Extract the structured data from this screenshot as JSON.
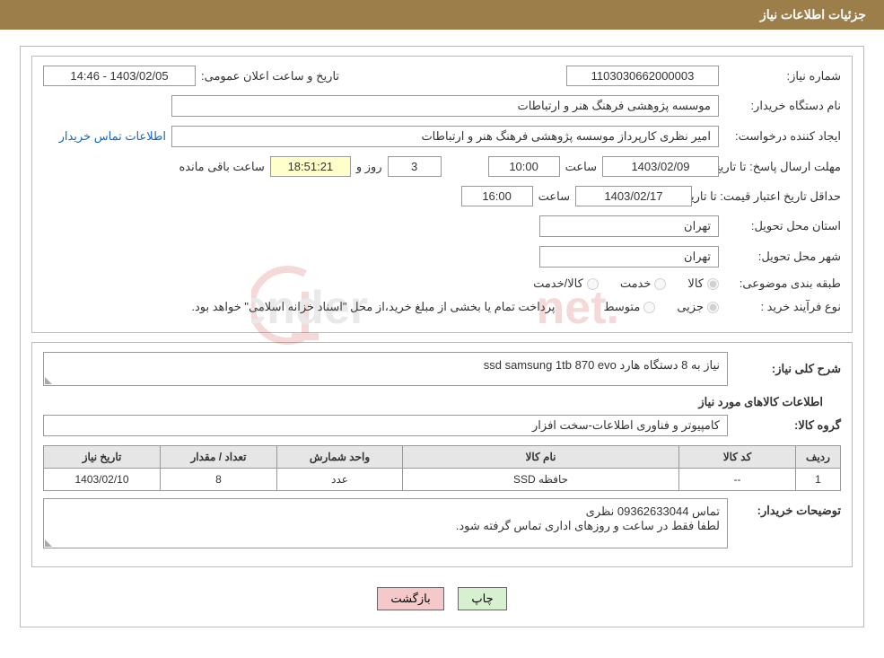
{
  "header": {
    "title": "جزئیات اطلاعات نیاز"
  },
  "info": {
    "need_no_label": "شماره نیاز:",
    "need_no": "1103030662000003",
    "announce_label": "تاریخ و ساعت اعلان عمومی:",
    "announce_value": "1403/02/05 - 14:46",
    "buyer_org_label": "نام دستگاه خریدار:",
    "buyer_org": "موسسه پژوهشی فرهنگ  هنر و ارتباطات",
    "requester_label": "ایجاد کننده درخواست:",
    "requester": "امیر نظری کارپرداز موسسه پژوهشی فرهنگ  هنر و ارتباطات",
    "contact_link": "اطلاعات تماس خریدار",
    "deadline_label": "مهلت ارسال پاسخ: تا تاریخ:",
    "deadline_date": "1403/02/09",
    "time_label": "ساعت",
    "deadline_time": "10:00",
    "days_remain": "3",
    "days_and_label": "روز و",
    "hms_remain": "18:51:21",
    "remain_label": "ساعت باقی مانده",
    "min_validity_label": "حداقل تاریخ اعتبار قیمت: تا تاریخ:",
    "min_validity_date": "1403/02/17",
    "min_validity_time": "16:00",
    "province_label": "استان محل تحویل:",
    "province": "تهران",
    "city_label": "شهر محل تحویل:",
    "city": "تهران",
    "category_label": "طبقه بندی موضوعی:",
    "cat_goods": "کالا",
    "cat_service": "خدمت",
    "cat_goods_service": "کالا/خدمت",
    "purchase_type_label": "نوع فرآیند خرید :",
    "pt_partial": "جزیی",
    "pt_medium": "متوسط",
    "purchase_desc": "پرداخت تمام یا بخشی از مبلغ خرید،از محل \"اسناد خزانه اسلامی\" خواهد بود."
  },
  "need": {
    "summary_label": "شرح کلی نیاز:",
    "summary": "نیاز به 8 دستگاه هارد ssd samsung 1tb 870 evo",
    "items_title": "اطلاعات کالاهای مورد نیاز",
    "group_label": "گروه کالا:",
    "group": "کامپیوتر و فناوری اطلاعات-سخت افزار",
    "table": {
      "headers": [
        "ردیف",
        "کد کالا",
        "نام کالا",
        "واحد شمارش",
        "تعداد / مقدار",
        "تاریخ نیاز"
      ],
      "rows": [
        {
          "idx": "1",
          "code": "--",
          "name": "حافظه SSD",
          "unit": "عدد",
          "qty": "8",
          "date": "1403/02/10"
        }
      ]
    },
    "buyer_notes_label": "توضیحات خریدار:",
    "buyer_notes_line1": "تماس 09362633044 نظری",
    "buyer_notes_line2": "لطفا فقط در ساعت و روزهای اداری تماس گرفته شود."
  },
  "buttons": {
    "print": "چاپ",
    "back": "بازگشت"
  },
  "watermark": {
    "text": "AriaTender.net"
  }
}
